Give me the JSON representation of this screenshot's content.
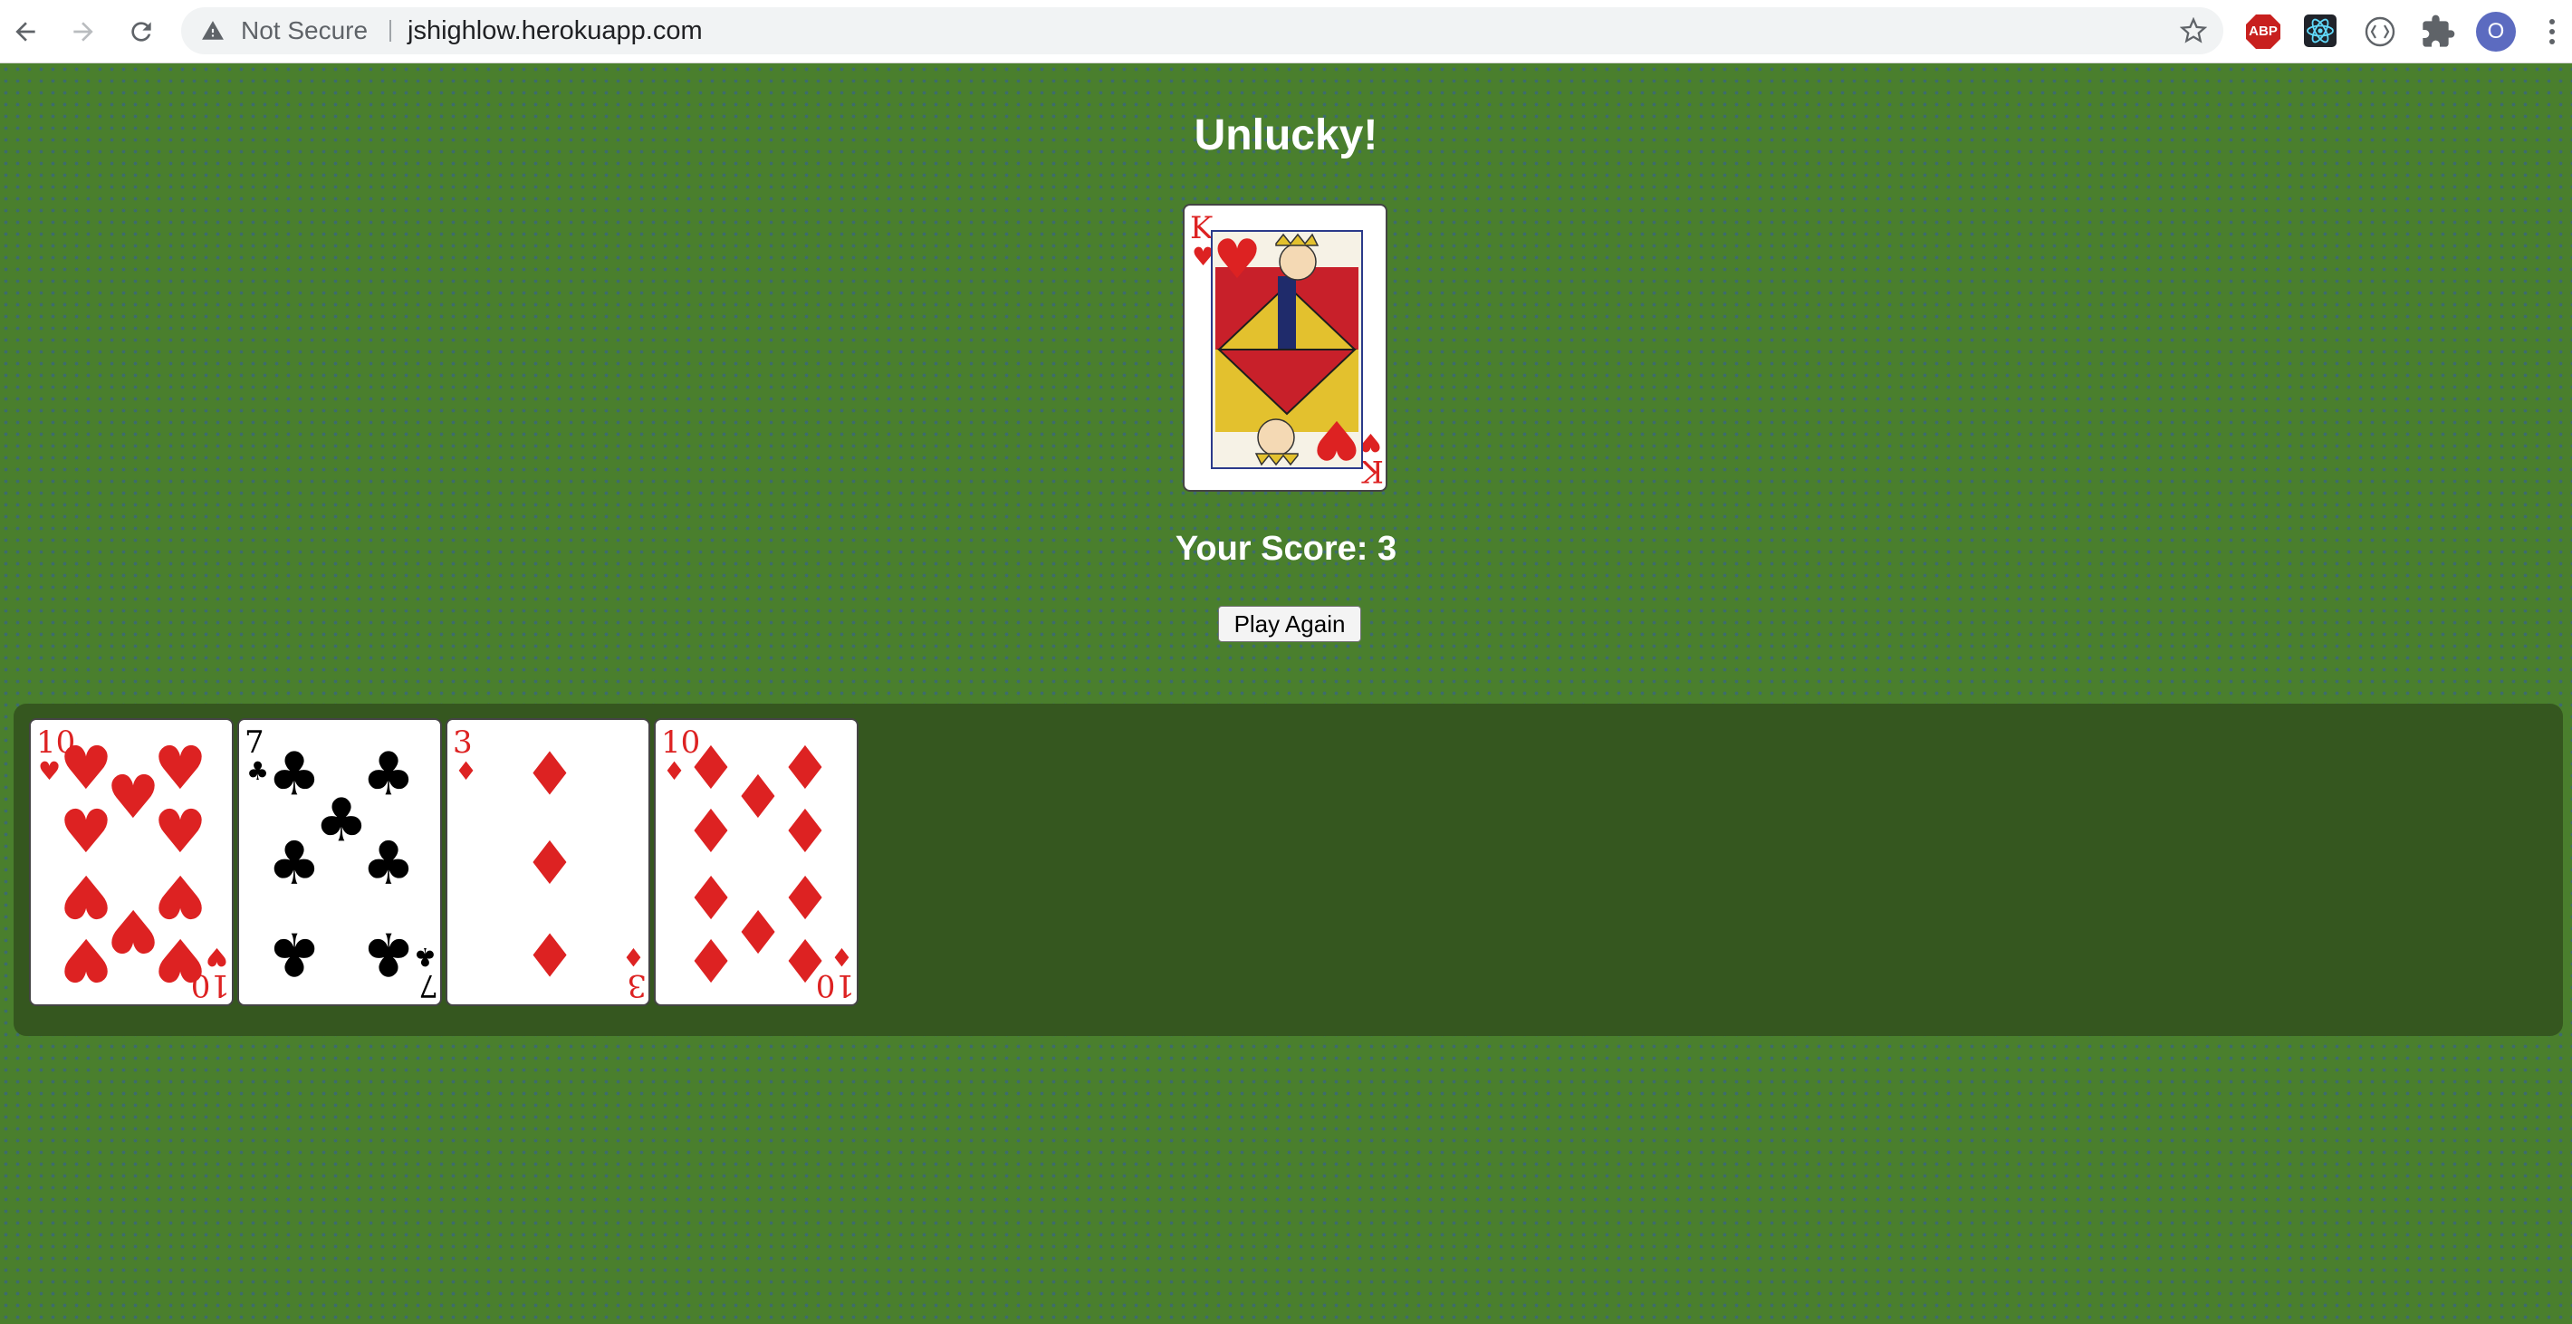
{
  "browser": {
    "security_label": "Not Secure",
    "url": "jshighlow.herokuapp.com",
    "extensions": {
      "adblock_label": "ABP"
    },
    "profile_initial": "O"
  },
  "game": {
    "result_title": "Unlucky!",
    "score_text": "Your Score: 3",
    "play_again_label": "Play Again",
    "current_card": {
      "rank": "K",
      "suit": "hearts",
      "suit_symbol": "♥",
      "color": "#d22"
    },
    "history": [
      {
        "rank": "10",
        "suit": "hearts",
        "suit_symbol": "♥",
        "color": "#d22"
      },
      {
        "rank": "7",
        "suit": "clubs",
        "suit_symbol": "♣",
        "color": "#000000"
      },
      {
        "rank": "3",
        "suit": "diamonds",
        "suit_symbol": "♦",
        "color": "#d22"
      },
      {
        "rank": "10",
        "suit": "diamonds",
        "suit_symbol": "♦",
        "color": "#d22"
      }
    ]
  },
  "colors": {
    "table_felt": "#4a7f2d",
    "tray": "#35571f",
    "red_suit": "#d22",
    "black_suit": "#000000"
  }
}
